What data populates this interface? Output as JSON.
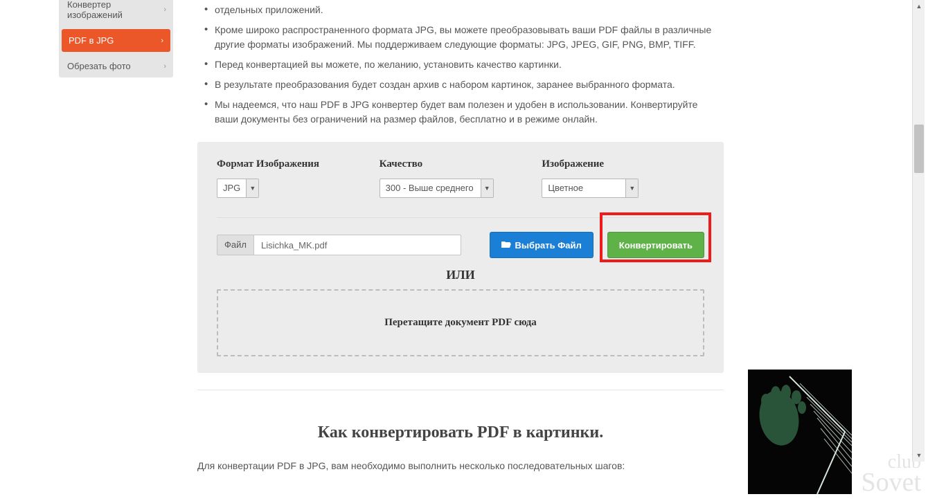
{
  "sidebar": {
    "items": [
      {
        "label": "Конвертер изображений"
      },
      {
        "label": "PDF в JPG"
      },
      {
        "label": "Обрезать фото"
      }
    ]
  },
  "description": {
    "bullets": [
      "отдельных приложений.",
      "Кроме широко распространенного формата JPG, вы можете преобразовывать ваши PDF файлы в различные другие форматы изображений. Мы поддерживаем следующие форматы: JPG, JPEG, GIF, PNG, BMP, TIFF.",
      "Перед конвертацией вы можете, по желанию, установить качество картинки.",
      "В результате преобразования будет создан архив с набором картинок, заранее выбранного формата.",
      "Мы надеемся, что наш PDF в JPG конвертер будет вам полезен и удобен в использовании. Конвертируйте ваши документы без ограничений на размер файлов, бесплатно и в режиме онлайн."
    ]
  },
  "panel": {
    "format_label": "Формат Изображения",
    "format_value": "JPG",
    "quality_label": "Качество",
    "quality_value": "300 - Выше среднего",
    "image_label": "Изображение",
    "image_value": "Цветное",
    "file_label": "Файл",
    "file_value": "Lisichka_MK.pdf",
    "choose_file": "Выбрать Файл",
    "convert": "Конвертировать",
    "or": "ИЛИ",
    "dropzone": "Перетащите документ PDF сюда"
  },
  "section": {
    "heading": "Как конвертировать PDF в картинки.",
    "intro": "Для конвертации PDF в JPG, вам необходимо выполнить несколько последовательных шагов:"
  },
  "watermark": {
    "line1": "club",
    "line2": "Sovet"
  }
}
